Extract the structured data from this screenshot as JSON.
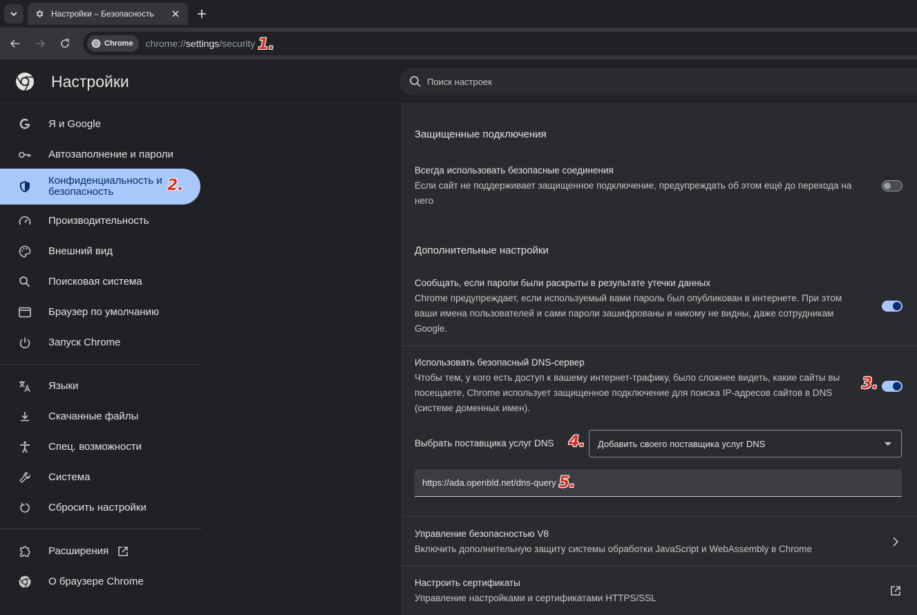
{
  "browser": {
    "tab_title": "Настройки – Безопасность",
    "omnibox_chip": "Chrome",
    "url_scheme": "chrome://",
    "url_host": "settings",
    "url_path": "/security"
  },
  "header": {
    "title": "Настройки",
    "search_placeholder": "Поиск настроек"
  },
  "sidebar": {
    "items": [
      {
        "label": "Я и Google",
        "icon": "google-icon"
      },
      {
        "label": "Автозаполнение и пароли",
        "icon": "key-icon"
      },
      {
        "label": "Конфиденциальность и безопасность",
        "icon": "shield-icon"
      },
      {
        "label": "Производительность",
        "icon": "speedometer-icon"
      },
      {
        "label": "Внешний вид",
        "icon": "palette-icon"
      },
      {
        "label": "Поисковая система",
        "icon": "search-icon"
      },
      {
        "label": "Браузер по умолчанию",
        "icon": "browser-window-icon"
      },
      {
        "label": "Запуск Chrome",
        "icon": "power-icon"
      },
      {
        "label": "Языки",
        "icon": "translate-icon"
      },
      {
        "label": "Скачанные файлы",
        "icon": "download-icon"
      },
      {
        "label": "Спец. возможности",
        "icon": "accessibility-icon"
      },
      {
        "label": "Система",
        "icon": "wrench-icon"
      },
      {
        "label": "Сбросить настройки",
        "icon": "reset-icon"
      },
      {
        "label": "Расширения",
        "icon": "puzzle-icon"
      },
      {
        "label": "О браузере Chrome",
        "icon": "chrome-icon"
      }
    ],
    "active_index": 2
  },
  "main": {
    "secure_connections": {
      "section_title": "Защищенные подключения",
      "always_https": {
        "title": "Всегда использовать безопасные соединения",
        "desc": "Если сайт не поддерживает защищенное подключение, предупреждать об этом ещё до перехода на него",
        "enabled": false
      }
    },
    "advanced": {
      "section_title": "Дополнительные настройки",
      "password_leak": {
        "title": "Сообщать, если пароли были раскрыты в результате утечки данных",
        "desc": "Chrome предупреждает, если используемый вами пароль был опубликован в интернете. При этом ваши имена пользователей и сами пароли зашифрованы и никому не видны, даже сотрудникам Google.",
        "enabled": true
      },
      "secure_dns": {
        "title": "Использовать безопасный DNS-сервер",
        "desc": "Чтобы тем, у кого есть доступ к вашему интернет-трафику, было сложнее видеть, какие сайты вы посещаете, Chrome использует защищенное подключение для поиска IP-адресов сайтов в DNS (системе доменных имен).",
        "enabled": true,
        "provider_label": "Выбрать поставщика услуг DNS",
        "provider_value": "Добавить своего поставщика услуг DNS",
        "custom_url": "https://ada.openbld.net/dns-query"
      },
      "v8_security": {
        "title": "Управление безопасностью V8",
        "desc": "Включить дополнительную защиту системы обработки JavaScript и WebAssembly в Chrome"
      },
      "certificates": {
        "title": "Настроить сертификаты",
        "desc": "Управление настройками и сертификатами HTTPS/SSL"
      }
    }
  },
  "annotations": [
    "1.",
    "2.",
    "3.",
    "4.",
    "5."
  ],
  "colors": {
    "accent": "#a8c7fa",
    "accent_dark": "#062e6f",
    "marker": "#d93025",
    "background": "#202124",
    "surface": "#2a2b2e"
  }
}
